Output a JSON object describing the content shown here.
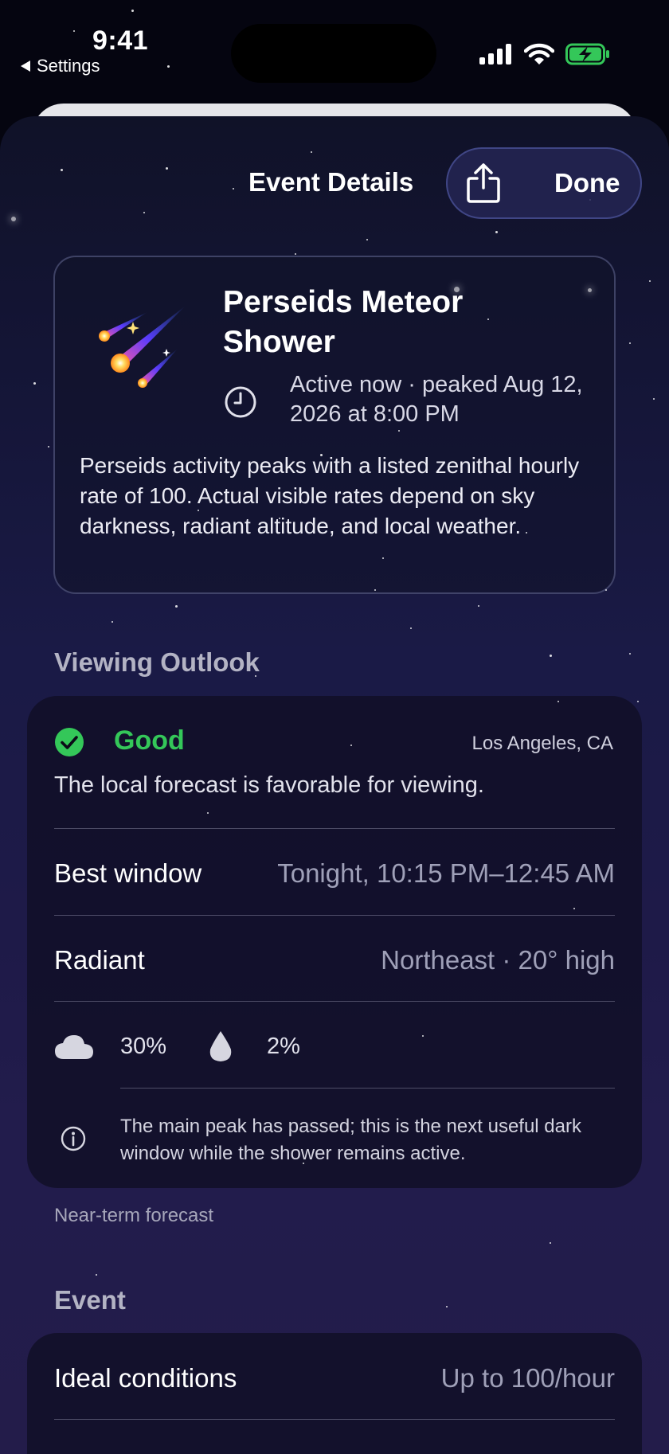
{
  "status_bar": {
    "time": "9:41",
    "back_label": "Settings"
  },
  "header": {
    "title": "Event Details",
    "done_label": "Done",
    "share_icon": "share-icon"
  },
  "event": {
    "icon": "meteor-icon",
    "name": "Perseids Meteor Shower",
    "status": "Active now · peaked Aug 12, 2026 at 8:00 PM",
    "description": "Perseids activity peaks with a listed zenithal hourly rate of 100. Actual visible rates depend on sky darkness, radiant altitude, and local weather."
  },
  "viewing_outlook": {
    "section_title": "Viewing Outlook",
    "rating": "Good",
    "rating_color": "#34c759",
    "location": "Los Angeles, CA",
    "summary": "The local forecast is favorable for viewing.",
    "rows": [
      {
        "label": "Best window",
        "value": "Tonight, 10:15 PM–12:45 AM"
      },
      {
        "label": "Radiant",
        "value": "Northeast · 20° high"
      }
    ],
    "cloud_cover": "30%",
    "precipitation": "2%",
    "note": "The main peak has passed; this is the next useful dark window while the shower remains active.",
    "footer": "Near-term forecast"
  },
  "event_section": {
    "section_title": "Event",
    "rows": [
      {
        "label": "Ideal conditions",
        "value": "Up to 100/hour"
      }
    ]
  }
}
